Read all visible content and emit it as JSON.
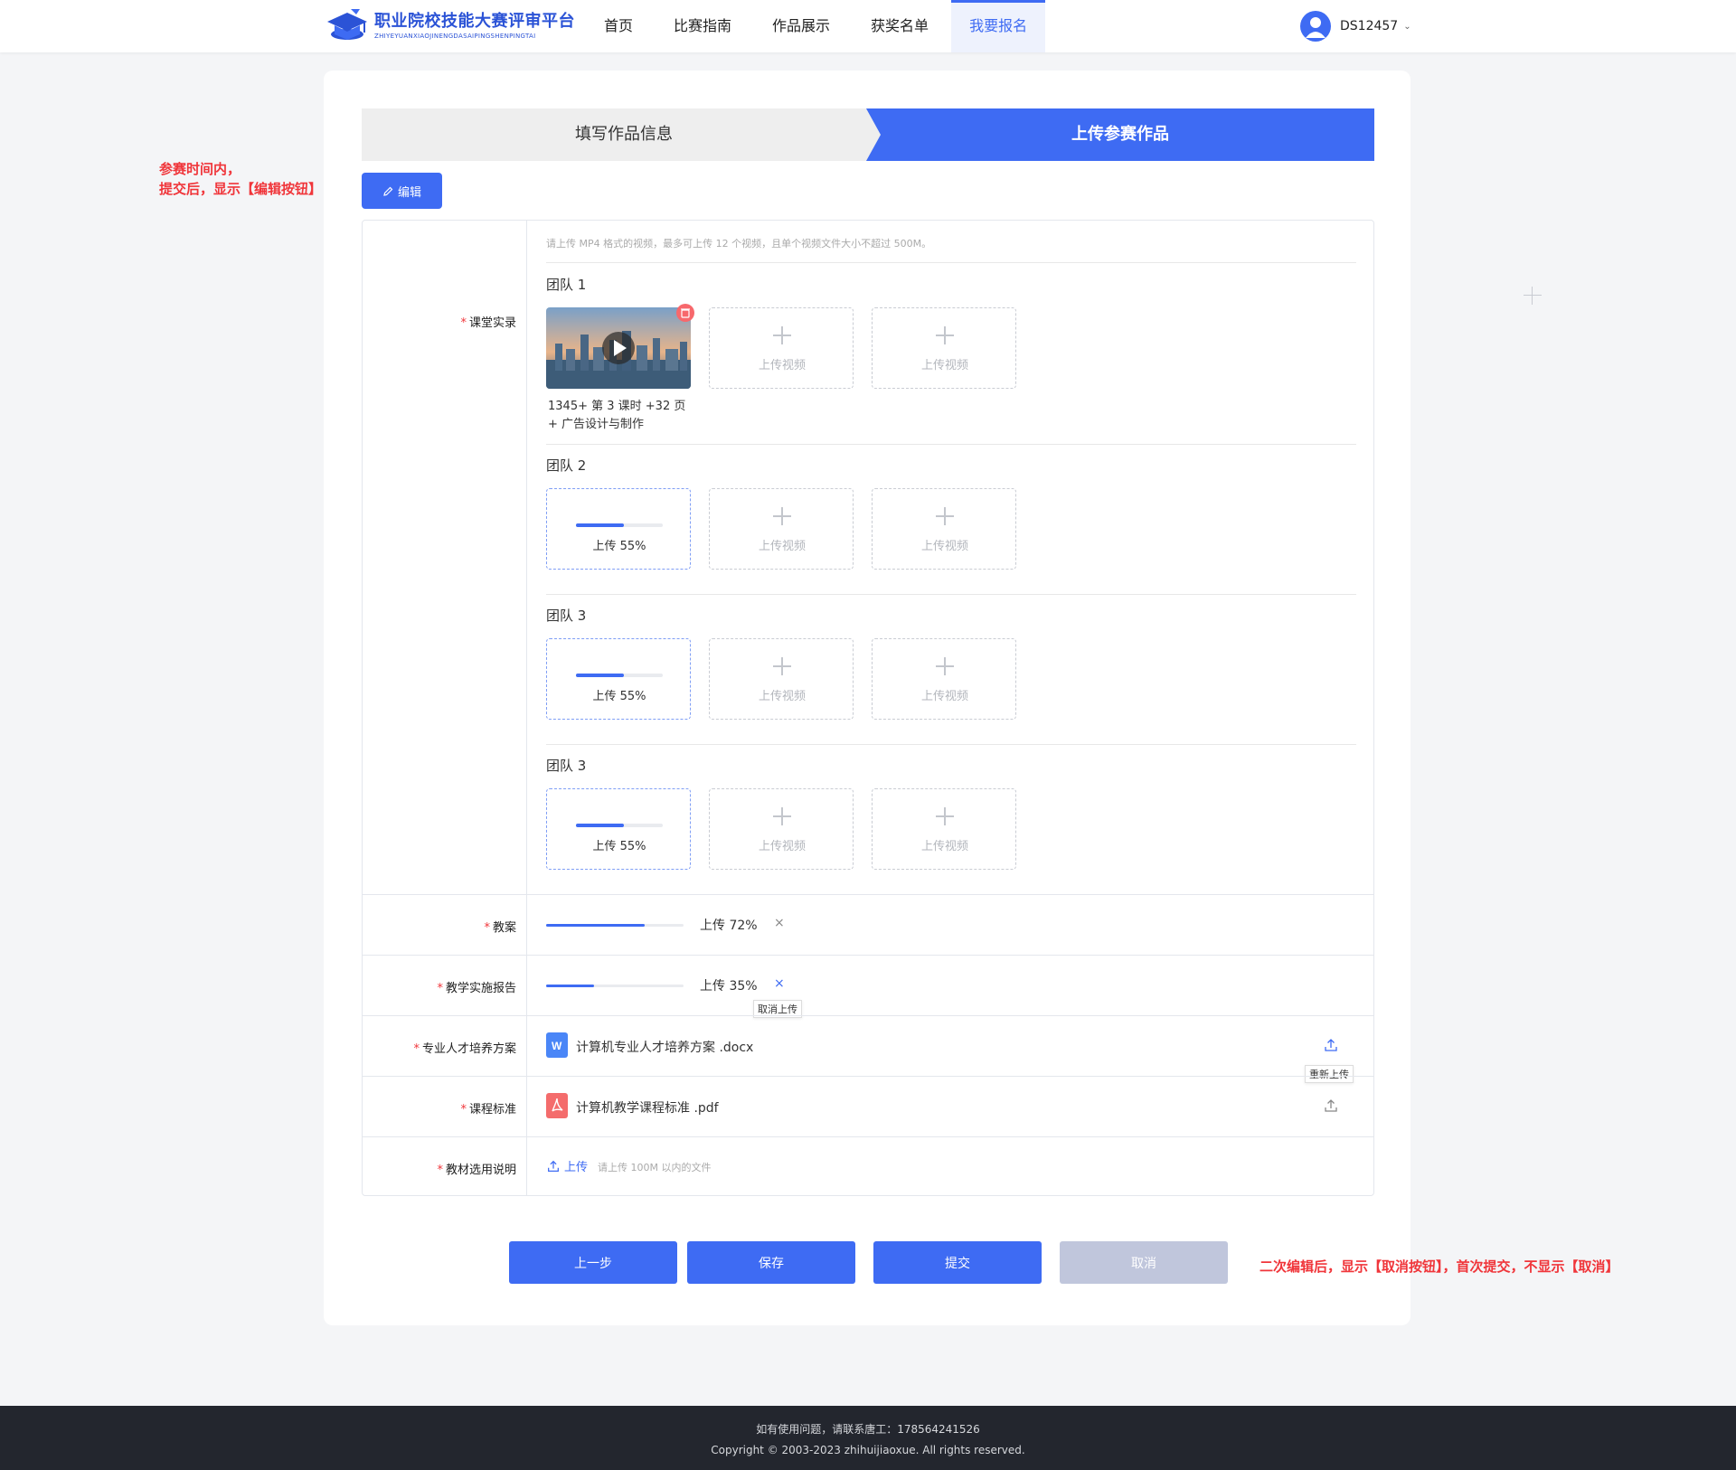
{
  "header": {
    "logo_title": "职业院校技能大赛评审平台",
    "logo_sub": "ZHIYEYUANXIAOJINENGDASAIPINGSHENPINGTAI",
    "nav": [
      {
        "label": "首页"
      },
      {
        "label": "比赛指南"
      },
      {
        "label": "作品展示"
      },
      {
        "label": "获奖名单"
      },
      {
        "label": "我要报名",
        "active": true
      }
    ],
    "user": "DS12457"
  },
  "steps": {
    "step1": "填写作品信息",
    "step2": "上传参赛作品"
  },
  "annotations": {
    "edit_note_line1": "参赛时间内，",
    "edit_note_line2": "提交后，显示【编辑按钮】",
    "cancel_note": "二次编辑后，显示【取消按钮】，首次提交，不显示【取消】"
  },
  "edit_button": "编辑",
  "form": {
    "classroom": {
      "label": "课堂实录",
      "hint": "请上传 MP4 格式的视频，最多可上传 12 个视频，且单个视频文件大小不超过 500M。",
      "teams": [
        {
          "name": "团队 1"
        },
        {
          "name": "团队 2"
        },
        {
          "name": "团队 3"
        },
        {
          "name": "团队 3"
        }
      ],
      "video_caption_line1": "1345+ 第 3 课时 +32 页",
      "video_caption_line2": "+ 广告设计与制作",
      "upload_tile_label": "上传视频",
      "progress_label": "上传 55%",
      "progress_value": 0.55
    },
    "lesson_plan": {
      "label": "教案",
      "progress_label": "上传 72%",
      "progress_value": 0.72,
      "close": "×"
    },
    "report": {
      "label": "教学实施报告",
      "progress_label": "上传 35%",
      "progress_value": 0.35,
      "close": "×",
      "tooltip": "取消上传"
    },
    "talent_plan": {
      "label": "专业人才培养方案",
      "file": "计算机专业人才培养方案 .docx",
      "tooltip": "重新上传"
    },
    "course_std": {
      "label": "课程标准",
      "file": "计算机教学课程标准 .pdf"
    },
    "textbook": {
      "label": "教材选用说明",
      "upload": "上传",
      "hint": "请上传 100M 以内的文件"
    }
  },
  "buttons": {
    "prev": "上一步",
    "save": "保存",
    "submit": "提交",
    "cancel": "取消"
  },
  "footer": {
    "line1": "如有使用问题，请联系唐工：178564241526",
    "line2": "Copyright © 2003-2023 zhihuijiaoxue. All rights reserved."
  },
  "colors": {
    "primary": "#3e6bf3",
    "danger": "#f0353a",
    "disabled": "#c0c6dc"
  }
}
